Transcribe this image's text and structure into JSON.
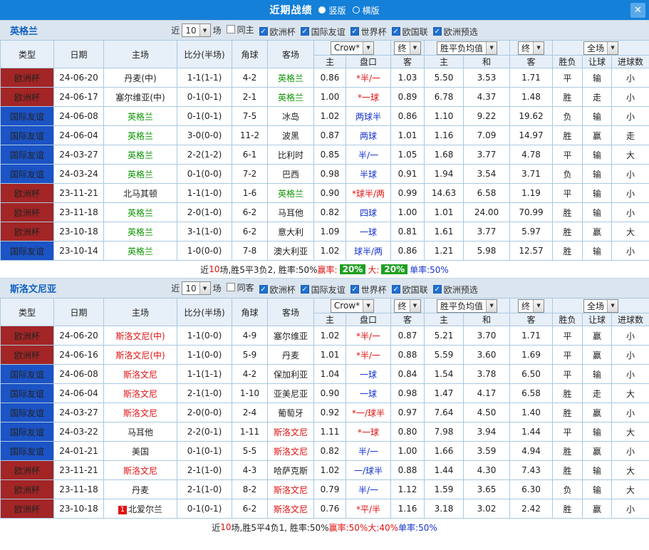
{
  "topbar": {
    "title": "近期战绩",
    "vertical": "竖版",
    "horizontal": "横版",
    "close": "✕"
  },
  "labels": {
    "near": "近",
    "matches": "场"
  },
  "controls": {
    "bookmaker": "Crow*",
    "final": "终",
    "odds_avg": "胜平负均值",
    "scope": "全场"
  },
  "headers": {
    "type": "类型",
    "date": "日期",
    "home": "主场",
    "score": "比分(半场)",
    "corner": "角球",
    "away": "客场",
    "h": "主",
    "handicap": "盘口",
    "a": "客",
    "draw": "和",
    "result": "胜负",
    "let": "让球",
    "goals": "进球数"
  },
  "colors": {
    "topbar_blue": "#1580d8",
    "euro_cup_red": "#a32525",
    "friendly_blue": "#1c53c5",
    "win_red": "#e01212",
    "lose_green": "#0a9400",
    "odds_blue": "#1533cc",
    "summary_green_badge": "#1ea021"
  },
  "sections": [
    {
      "team": "英格兰",
      "filters": {
        "count": "10",
        "checkboxes": [
          {
            "label": "同主",
            "checked": false
          },
          {
            "label": "欧洲杯",
            "checked": true
          },
          {
            "label": "国际友谊",
            "checked": true
          },
          {
            "label": "世界杯",
            "checked": true
          },
          {
            "label": "欧国联",
            "checked": true
          },
          {
            "label": "欧洲预选",
            "checked": true
          }
        ]
      },
      "rows": [
        {
          "type": "欧洲杯",
          "tc": "euro",
          "date": "24-06-20",
          "home": "丹麦(中)",
          "hc": "",
          "score": "1-1(1-1)",
          "corner": "4-2",
          "away": "英格兰",
          "ac": "green",
          "ah": "0.86",
          "hcap": "*半/一",
          "hpc": "red",
          "aa": "1.03",
          "oh": "5.50",
          "od": "3.53",
          "oa": "1.71",
          "res": "平",
          "rc": "k",
          "hr": "输",
          "hrc": "green",
          "gl": "小",
          "glc": "green"
        },
        {
          "type": "欧洲杯",
          "tc": "euro",
          "date": "24-06-17",
          "home": "塞尔维亚(中)",
          "hc": "",
          "score": "0-1(0-1)",
          "corner": "2-1",
          "away": "英格兰",
          "ac": "green",
          "ah": "1.00",
          "hcap": "*一球",
          "hpc": "red",
          "aa": "0.89",
          "oh": "6.78",
          "od": "4.37",
          "oa": "1.48",
          "res": "胜",
          "rc": "red",
          "hr": "走",
          "hrc": "blue",
          "gl": "小",
          "glc": "green"
        },
        {
          "type": "国际友谊",
          "tc": "friendly",
          "date": "24-06-08",
          "home": "英格兰",
          "hc": "green",
          "score": "0-1(0-1)",
          "corner": "7-5",
          "away": "冰岛",
          "ac": "",
          "ah": "1.02",
          "hcap": "两球半",
          "hpc": "blue",
          "aa": "0.86",
          "oh": "1.10",
          "od": "9.22",
          "oa": "19.62",
          "res": "负",
          "rc": "green",
          "hr": "输",
          "hrc": "green",
          "gl": "小",
          "glc": "green"
        },
        {
          "type": "国际友谊",
          "tc": "friendly",
          "date": "24-06-04",
          "home": "英格兰",
          "hc": "green",
          "score": "3-0(0-0)",
          "corner": "11-2",
          "away": "波黑",
          "ac": "",
          "ah": "0.87",
          "hcap": "两球",
          "hpc": "blue",
          "aa": "1.01",
          "oh": "1.16",
          "od": "7.09",
          "oa": "14.97",
          "res": "胜",
          "rc": "red",
          "hr": "赢",
          "hrc": "red",
          "gl": "走",
          "glc": "blue"
        },
        {
          "type": "国际友谊",
          "tc": "friendly",
          "date": "24-03-27",
          "home": "英格兰",
          "hc": "green",
          "score": "2-2(1-2)",
          "corner": "6-1",
          "away": "比利时",
          "ac": "",
          "ah": "0.85",
          "hcap": "半/一",
          "hpc": "blue",
          "aa": "1.05",
          "oh": "1.68",
          "od": "3.77",
          "oa": "4.78",
          "res": "平",
          "rc": "k",
          "hr": "输",
          "hrc": "green",
          "gl": "大",
          "glc": "red"
        },
        {
          "type": "国际友谊",
          "tc": "friendly",
          "date": "24-03-24",
          "home": "英格兰",
          "hc": "green",
          "score": "0-1(0-0)",
          "corner": "7-2",
          "away": "巴西",
          "ac": "",
          "ah": "0.98",
          "hcap": "半球",
          "hpc": "blue",
          "aa": "0.91",
          "oh": "1.94",
          "od": "3.54",
          "oa": "3.71",
          "res": "负",
          "rc": "green",
          "hr": "输",
          "hrc": "green",
          "gl": "小",
          "glc": "green"
        },
        {
          "type": "欧洲杯",
          "tc": "euro",
          "date": "23-11-21",
          "home": "北马其顿",
          "hc": "",
          "score": "1-1(1-0)",
          "corner": "1-6",
          "away": "英格兰",
          "ac": "green",
          "ah": "0.90",
          "hcap": "*球半/两",
          "hpc": "red",
          "aa": "0.99",
          "oh": "14.63",
          "od": "6.58",
          "oa": "1.19",
          "res": "平",
          "rc": "k",
          "hr": "输",
          "hrc": "green",
          "gl": "小",
          "glc": "green"
        },
        {
          "type": "欧洲杯",
          "tc": "euro",
          "date": "23-11-18",
          "home": "英格兰",
          "hc": "green",
          "score": "2-0(1-0)",
          "corner": "6-2",
          "away": "马耳他",
          "ac": "",
          "ah": "0.82",
          "hcap": "四球",
          "hpc": "blue",
          "aa": "1.00",
          "oh": "1.01",
          "od": "24.00",
          "oa": "70.99",
          "res": "胜",
          "rc": "red",
          "hr": "输",
          "hrc": "green",
          "gl": "小",
          "glc": "green"
        },
        {
          "type": "欧洲杯",
          "tc": "euro",
          "date": "23-10-18",
          "home": "英格兰",
          "hc": "green",
          "score": "3-1(1-0)",
          "corner": "6-2",
          "away": "意大利",
          "ac": "",
          "ah": "1.09",
          "hcap": "一球",
          "hpc": "blue",
          "aa": "0.81",
          "oh": "1.61",
          "od": "3.77",
          "oa": "5.97",
          "res": "胜",
          "rc": "red",
          "hr": "赢",
          "hrc": "red",
          "gl": "大",
          "glc": "red"
        },
        {
          "type": "国际友谊",
          "tc": "friendly",
          "date": "23-10-14",
          "home": "英格兰",
          "hc": "green",
          "score": "1-0(0-0)",
          "corner": "7-8",
          "away": "澳大利亚",
          "ac": "",
          "ah": "1.02",
          "hcap": "球半/两",
          "hpc": "blue",
          "aa": "0.86",
          "oh": "1.21",
          "od": "5.98",
          "oa": "12.57",
          "res": "胜",
          "rc": "red",
          "hr": "输",
          "hrc": "green",
          "gl": "小",
          "glc": "green"
        }
      ],
      "summary": [
        {
          "t": "近",
          "c": "k"
        },
        {
          "t": "10",
          "c": "r"
        },
        {
          "t": "场,胜5平3负2, 胜率:50% ",
          "c": "k"
        },
        {
          "t": "赢率:",
          "c": "r"
        },
        {
          "t": "20%",
          "c": "gb"
        },
        {
          "t": " 大:",
          "c": "r"
        },
        {
          "t": "20%",
          "c": "gb"
        },
        {
          "t": " 单率:50%",
          "c": "b"
        }
      ]
    },
    {
      "team": "斯洛文尼亚",
      "filters": {
        "count": "10",
        "checkboxes": [
          {
            "label": "同客",
            "checked": false
          },
          {
            "label": "欧洲杯",
            "checked": true
          },
          {
            "label": "国际友谊",
            "checked": true
          },
          {
            "label": "世界杯",
            "checked": true
          },
          {
            "label": "欧国联",
            "checked": true
          },
          {
            "label": "欧洲预选",
            "checked": true
          }
        ]
      },
      "rows": [
        {
          "type": "欧洲杯",
          "tc": "euro",
          "date": "24-06-20",
          "home": "斯洛文尼(中)",
          "hc": "red",
          "score": "1-1(0-0)",
          "corner": "4-9",
          "away": "塞尔维亚",
          "ac": "",
          "ah": "1.02",
          "hcap": "*半/一",
          "hpc": "red",
          "aa": "0.87",
          "oh": "5.21",
          "od": "3.70",
          "oa": "1.71",
          "res": "平",
          "rc": "k",
          "hr": "赢",
          "hrc": "red",
          "gl": "小",
          "glc": "green"
        },
        {
          "type": "欧洲杯",
          "tc": "euro",
          "date": "24-06-16",
          "home": "斯洛文尼(中)",
          "hc": "red",
          "score": "1-1(0-0)",
          "corner": "5-9",
          "away": "丹麦",
          "ac": "",
          "ah": "1.01",
          "hcap": "*半/一",
          "hpc": "red",
          "aa": "0.88",
          "oh": "5.59",
          "od": "3.60",
          "oa": "1.69",
          "res": "平",
          "rc": "k",
          "hr": "赢",
          "hrc": "red",
          "gl": "小",
          "glc": "green"
        },
        {
          "type": "国际友谊",
          "tc": "friendly",
          "date": "24-06-08",
          "home": "斯洛文尼",
          "hc": "red",
          "score": "1-1(1-1)",
          "corner": "4-2",
          "away": "保加利亚",
          "ac": "",
          "ah": "1.04",
          "hcap": "一球",
          "hpc": "blue",
          "aa": "0.84",
          "oh": "1.54",
          "od": "3.78",
          "oa": "6.50",
          "res": "平",
          "rc": "k",
          "hr": "输",
          "hrc": "green",
          "gl": "小",
          "glc": "green"
        },
        {
          "type": "国际友谊",
          "tc": "friendly",
          "date": "24-06-04",
          "home": "斯洛文尼",
          "hc": "red",
          "score": "2-1(1-0)",
          "corner": "1-10",
          "away": "亚美尼亚",
          "ac": "",
          "ah": "0.90",
          "hcap": "一球",
          "hpc": "blue",
          "aa": "0.98",
          "oh": "1.47",
          "od": "4.17",
          "oa": "6.58",
          "res": "胜",
          "rc": "red",
          "hr": "走",
          "hrc": "blue",
          "gl": "大",
          "glc": "red"
        },
        {
          "type": "国际友谊",
          "tc": "friendly",
          "date": "24-03-27",
          "home": "斯洛文尼",
          "hc": "red",
          "score": "2-0(0-0)",
          "corner": "2-4",
          "away": "葡萄牙",
          "ac": "",
          "ah": "0.92",
          "hcap": "*一/球半",
          "hpc": "red",
          "aa": "0.97",
          "oh": "7.64",
          "od": "4.50",
          "oa": "1.40",
          "res": "胜",
          "rc": "red",
          "hr": "赢",
          "hrc": "red",
          "gl": "小",
          "glc": "green"
        },
        {
          "type": "国际友谊",
          "tc": "friendly",
          "date": "24-03-22",
          "home": "马耳他",
          "hc": "",
          "score": "2-2(0-1)",
          "corner": "1-11",
          "away": "斯洛文尼",
          "ac": "red",
          "ah": "1.11",
          "hcap": "*一球",
          "hpc": "red",
          "aa": "0.80",
          "oh": "7.98",
          "od": "3.94",
          "oa": "1.44",
          "res": "平",
          "rc": "k",
          "hr": "输",
          "hrc": "green",
          "gl": "大",
          "glc": "red"
        },
        {
          "type": "国际友谊",
          "tc": "friendly",
          "date": "24-01-21",
          "home": "美国",
          "hc": "",
          "score": "0-1(0-1)",
          "corner": "5-5",
          "away": "斯洛文尼",
          "ac": "red",
          "ah": "0.82",
          "hcap": "半/一",
          "hpc": "blue",
          "aa": "1.00",
          "oh": "1.66",
          "od": "3.59",
          "oa": "4.94",
          "res": "胜",
          "rc": "red",
          "hr": "赢",
          "hrc": "red",
          "gl": "小",
          "glc": "green"
        },
        {
          "type": "欧洲杯",
          "tc": "euro",
          "date": "23-11-21",
          "home": "斯洛文尼",
          "hc": "red",
          "score": "2-1(1-0)",
          "corner": "4-3",
          "away": "哈萨克斯",
          "ac": "",
          "ah": "1.02",
          "hcap": "一/球半",
          "hpc": "blue",
          "aa": "0.88",
          "oh": "1.44",
          "od": "4.30",
          "oa": "7.43",
          "res": "胜",
          "rc": "red",
          "hr": "输",
          "hrc": "green",
          "gl": "大",
          "glc": "red"
        },
        {
          "type": "欧洲杯",
          "tc": "euro",
          "date": "23-11-18",
          "home": "丹麦",
          "hc": "",
          "score": "2-1(1-0)",
          "corner": "8-2",
          "away": "斯洛文尼",
          "ac": "red",
          "ah": "0.79",
          "hcap": "半/一",
          "hpc": "blue",
          "aa": "1.12",
          "oh": "1.59",
          "od": "3.65",
          "oa": "6.30",
          "res": "负",
          "rc": "green",
          "hr": "输",
          "hrc": "green",
          "gl": "大",
          "glc": "red"
        },
        {
          "type": "欧洲杯",
          "tc": "euro",
          "date": "23-10-18",
          "home": "北爱尔兰",
          "badge": "1",
          "hc": "",
          "score": "0-1(0-1)",
          "corner": "6-2",
          "away": "斯洛文尼",
          "ac": "red",
          "ah": "0.76",
          "hcap": "*平/半",
          "hpc": "red",
          "aa": "1.16",
          "oh": "3.18",
          "od": "3.02",
          "oa": "2.42",
          "res": "胜",
          "rc": "red",
          "hr": "赢",
          "hrc": "red",
          "gl": "小",
          "glc": "green"
        }
      ],
      "summary": [
        {
          "t": "近",
          "c": "k"
        },
        {
          "t": "10",
          "c": "r"
        },
        {
          "t": "场,胜5平4负1, 胜率:50% ",
          "c": "k"
        },
        {
          "t": "赢率:50%",
          "c": "r"
        },
        {
          "t": " 大:40%",
          "c": "r"
        },
        {
          "t": " 单率:50%",
          "c": "b"
        }
      ]
    }
  ]
}
